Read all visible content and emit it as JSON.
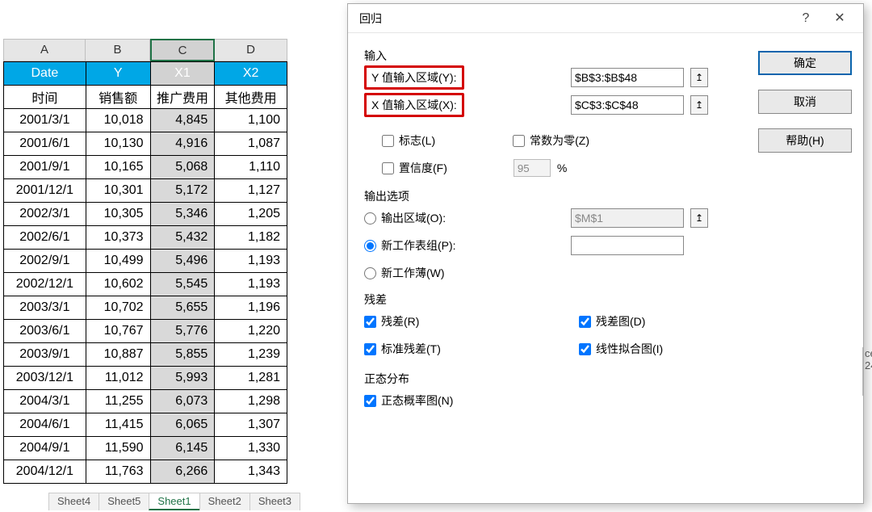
{
  "sheet": {
    "col_headers": [
      "A",
      "B",
      "C",
      "D"
    ],
    "head1": [
      "Date",
      "Y",
      "X1",
      "X2"
    ],
    "head2": [
      "时间",
      "销售额",
      "推广费用",
      "其他费用"
    ],
    "rows": [
      [
        "2001/3/1",
        "10,018",
        "4,845",
        "1,100"
      ],
      [
        "2001/6/1",
        "10,130",
        "4,916",
        "1,087"
      ],
      [
        "2001/9/1",
        "10,165",
        "5,068",
        "1,110"
      ],
      [
        "2001/12/1",
        "10,301",
        "5,172",
        "1,127"
      ],
      [
        "2002/3/1",
        "10,305",
        "5,346",
        "1,205"
      ],
      [
        "2002/6/1",
        "10,373",
        "5,432",
        "1,182"
      ],
      [
        "2002/9/1",
        "10,499",
        "5,496",
        "1,193"
      ],
      [
        "2002/12/1",
        "10,602",
        "5,545",
        "1,193"
      ],
      [
        "2003/3/1",
        "10,702",
        "5,655",
        "1,196"
      ],
      [
        "2003/6/1",
        "10,767",
        "5,776",
        "1,220"
      ],
      [
        "2003/9/1",
        "10,887",
        "5,855",
        "1,239"
      ],
      [
        "2003/12/1",
        "11,012",
        "5,993",
        "1,281"
      ],
      [
        "2004/3/1",
        "11,255",
        "6,073",
        "1,298"
      ],
      [
        "2004/6/1",
        "11,415",
        "6,065",
        "1,307"
      ],
      [
        "2004/9/1",
        "11,590",
        "6,145",
        "1,330"
      ],
      [
        "2004/12/1",
        "11,763",
        "6,266",
        "1,343"
      ]
    ],
    "tabs": [
      "Sheet4",
      "Sheet5",
      "Sheet1",
      "Sheet2",
      "Sheet3"
    ],
    "active_tab": 2
  },
  "dialog": {
    "title": "回归",
    "help_glyph": "?",
    "close_glyph": "✕",
    "ok": "确定",
    "cancel": "取消",
    "help": "帮助(H)",
    "section_input": "输入",
    "y_label": "Y 值输入区域(Y):",
    "y_value": "$B$3:$B$48",
    "x_label": "X 值输入区域(X):",
    "x_value": "$C$3:$C$48",
    "labels_cb": "标志(L)",
    "constzero_cb": "常数为零(Z)",
    "conf_cb": "置信度(F)",
    "conf_val": "95",
    "conf_pct": "%",
    "section_output": "输出选项",
    "out_range": "输出区域(O):",
    "out_range_val": "$M$1",
    "out_newsheet": "新工作表组(P):",
    "out_newsheet_val": "",
    "out_newbook": "新工作薄(W)",
    "section_resid": "残差",
    "resid_cb": "残差(R)",
    "residchart_cb": "残差图(D)",
    "stdresid_cb": "标准残差(T)",
    "linefit_cb": "线性拟合图(I)",
    "section_norm": "正态分布",
    "normprob_cb": "正态概率图(N)",
    "range_icon": "↥",
    "extra_hint": "24"
  }
}
